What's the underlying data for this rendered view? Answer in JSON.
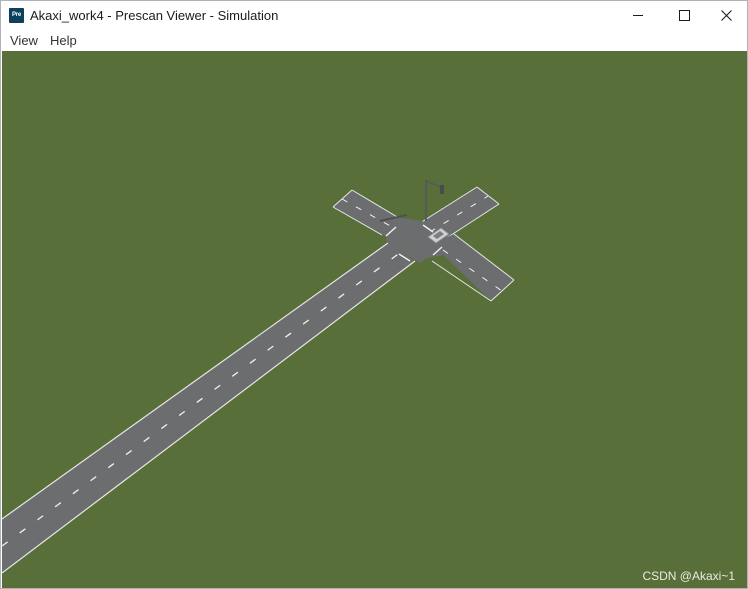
{
  "window": {
    "app_icon_text": "Pre",
    "title": "Akaxi_work4 - Prescan Viewer - Simulation",
    "controls": {
      "minimize_icon": "minimize-icon",
      "maximize_icon": "maximize-icon",
      "close_icon": "close-icon"
    }
  },
  "menu": {
    "items": [
      {
        "label": "View"
      },
      {
        "label": "Help"
      }
    ]
  },
  "viewport": {
    "colors": {
      "grass": "#596f39",
      "road": "#6c6d6f",
      "road_edge": "#e6e6e6",
      "lane_marking": "#f2f2f2"
    },
    "objects": [
      "straight-road",
      "x-intersection",
      "traffic-light-pole",
      "ego-vehicle"
    ]
  },
  "watermark": "CSDN @Akaxi~1"
}
